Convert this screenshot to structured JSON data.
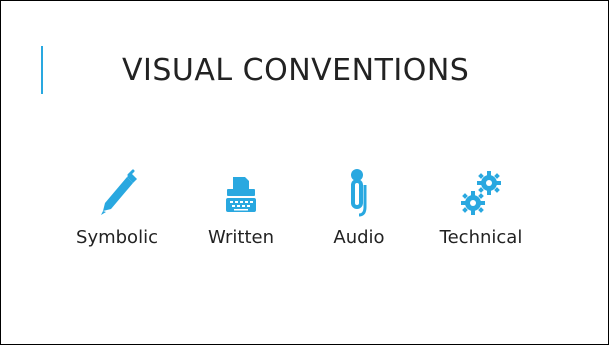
{
  "slide": {
    "title": "VISUAL CONVENTIONS",
    "accent_color": "#29a8e0",
    "items": [
      {
        "label": "Symbolic",
        "icon": "pen-icon"
      },
      {
        "label": "Written",
        "icon": "typewriter-icon"
      },
      {
        "label": "Audio",
        "icon": "microphone-icon"
      },
      {
        "label": "Technical",
        "icon": "gears-icon"
      }
    ]
  }
}
